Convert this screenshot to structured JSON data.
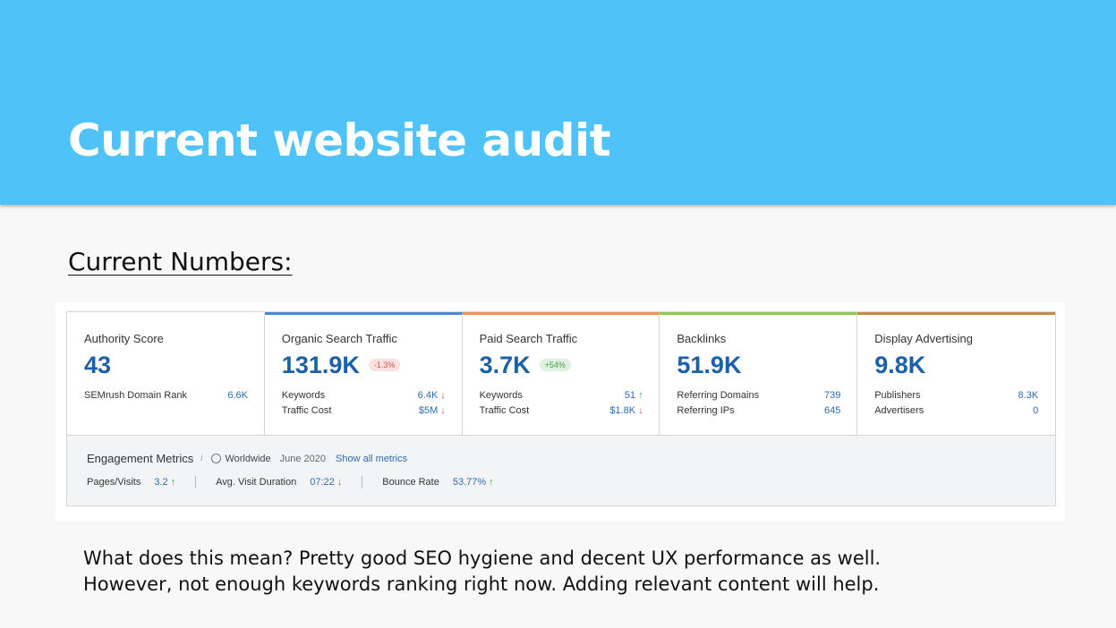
{
  "slide": {
    "title": "Current website audit",
    "section_heading": "Current Numbers:",
    "body_lines": [
      "What does this mean? Pretty good SEO hygiene and decent UX performance as well.",
      "However, not enough keywords ranking right now. Adding relevant content will help."
    ]
  },
  "colors": {
    "header": "#4fc2f8",
    "value_blue": "#1a61a8",
    "organic_accent": "#4a8bd0",
    "paid_accent": "#f0925a",
    "backlinks_accent": "#8cc95a",
    "display_accent": "#c5894a"
  },
  "cards": [
    {
      "label": "Authority Score",
      "value": "43",
      "badge": "",
      "rows": [
        {
          "label": "SEMrush Domain Rank",
          "value": "6.6K",
          "arrow": ""
        }
      ]
    },
    {
      "label": "Organic Search Traffic",
      "value": "131.9K",
      "badge": "-1.3%",
      "rows": [
        {
          "label": "Keywords",
          "value": "6.4K",
          "arrow": "↓"
        },
        {
          "label": "Traffic Cost",
          "value": "$5M",
          "arrow": "↓"
        }
      ]
    },
    {
      "label": "Paid Search Traffic",
      "value": "3.7K",
      "badge": "+54%",
      "rows": [
        {
          "label": "Keywords",
          "value": "51",
          "arrow": "↑"
        },
        {
          "label": "Traffic Cost",
          "value": "$1.8K",
          "arrow": "↓"
        }
      ]
    },
    {
      "label": "Backlinks",
      "value": "51.9K",
      "badge": "",
      "rows": [
        {
          "label": "Referring Domains",
          "value": "739",
          "arrow": ""
        },
        {
          "label": "Referring IPs",
          "value": "645",
          "arrow": ""
        }
      ]
    },
    {
      "label": "Display Advertising",
      "value": "9.8K",
      "badge": "",
      "rows": [
        {
          "label": "Publishers",
          "value": "8.3K",
          "arrow": ""
        },
        {
          "label": "Advertisers",
          "value": "0",
          "arrow": ""
        }
      ]
    }
  ],
  "engagement": {
    "title": "Engagement Metrics",
    "info": "i",
    "region": "Worldwide",
    "date": "June 2020",
    "link": "Show all metrics",
    "metrics": [
      {
        "label": "Pages/Visits",
        "value": "3.2",
        "arrow": "↑"
      },
      {
        "label": "Avg. Visit Duration",
        "value": "07:22",
        "arrow": "↓"
      },
      {
        "label": "Bounce Rate",
        "value": "53.77%",
        "arrow": "↑"
      }
    ]
  }
}
